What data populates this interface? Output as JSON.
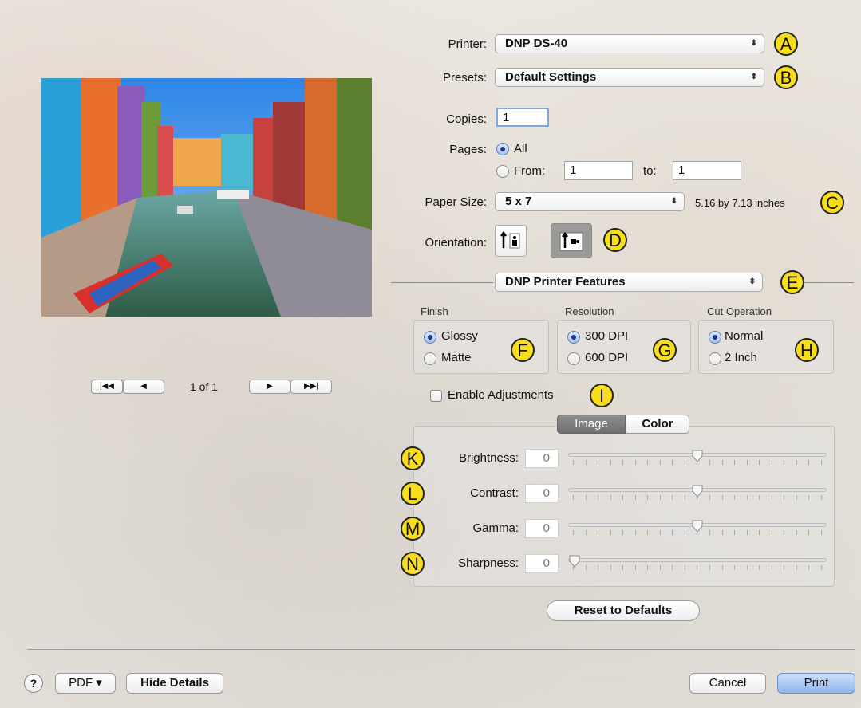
{
  "header": {
    "title": ""
  },
  "printer": {
    "label": "Printer:",
    "value": "DNP DS-40",
    "callout": "A"
  },
  "presets": {
    "label": "Presets:",
    "value": "Default Settings",
    "callout": "B"
  },
  "copies": {
    "label": "Copies:",
    "value": "1"
  },
  "pages": {
    "label": "Pages:",
    "all_label": "All",
    "from_label": "From:",
    "from_value": "1",
    "to_label": "to:",
    "to_value": "1"
  },
  "paper_size": {
    "label": "Paper Size:",
    "value": "5 x 7",
    "info": "5.16 by 7.13 inches",
    "callout": "C"
  },
  "orientation": {
    "label": "Orientation:",
    "callout": "D"
  },
  "section": {
    "value": "DNP Printer Features",
    "callout": "E"
  },
  "finish": {
    "label": "Finish",
    "options": [
      "Glossy",
      "Matte"
    ],
    "callout": "F"
  },
  "resolution": {
    "label": "Resolution",
    "options": [
      "300 DPI",
      "600 DPI"
    ],
    "callout": "G"
  },
  "cut": {
    "label": "Cut Operation",
    "options": [
      "Normal",
      "2 Inch"
    ],
    "callout": "H"
  },
  "adjust": {
    "label": "Enable Adjustments",
    "callout": "I"
  },
  "tabs": [
    "Image",
    "Color"
  ],
  "sliders": [
    {
      "label": "Brightness:",
      "value": "0",
      "callout": "K",
      "level": 0.5
    },
    {
      "label": "Contrast:",
      "value": "0",
      "callout": "L",
      "level": 0.5
    },
    {
      "label": "Gamma:",
      "value": "0",
      "callout": "M",
      "level": 0.5
    },
    {
      "label": "Sharpness:",
      "value": "0",
      "callout": "N",
      "level": 0.0
    }
  ],
  "reset_label": "Reset to Defaults",
  "preview": {
    "page_label": "1 of 1"
  },
  "footer": {
    "help": "?",
    "pdf": "PDF ▾",
    "hide_details": "Hide Details",
    "cancel": "Cancel",
    "print": "Print"
  },
  "colors": {
    "accent": "#1b79c7",
    "callout": "#f7dd1a"
  }
}
